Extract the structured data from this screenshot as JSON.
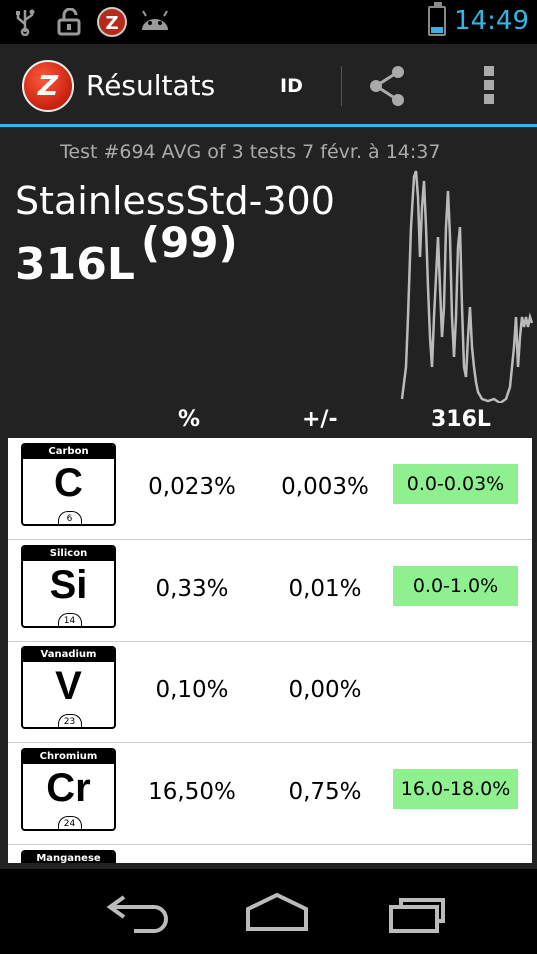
{
  "status_bar": {
    "time": "14:49",
    "icons": [
      "usb-icon",
      "unlock-icon",
      "app-z-icon",
      "android-icon",
      "battery-icon"
    ]
  },
  "action_bar": {
    "logo_letter": "Z",
    "title": "Résultats",
    "id_label": "ID",
    "icons": [
      "share-icon",
      "overflow-menu-icon"
    ]
  },
  "result": {
    "subtitle": "Test #694 AVG of 3 tests 7 févr. à 14:37",
    "alloy_family": "StainlessStd-300",
    "grade": "316L",
    "match_score": "(99)"
  },
  "table": {
    "headers": {
      "percent": "%",
      "error": "+/-",
      "grade": "316L"
    },
    "rows": [
      {
        "element_name": "Carbon",
        "symbol": "C",
        "atomic_number": "6",
        "percent": "0,023%",
        "error": "0,003%",
        "range": "0.0-0.03%"
      },
      {
        "element_name": "Silicon",
        "symbol": "Si",
        "atomic_number": "14",
        "percent": "0,33%",
        "error": "0,01%",
        "range": "0.0-1.0%"
      },
      {
        "element_name": "Vanadium",
        "symbol": "V",
        "atomic_number": "23",
        "percent": "0,10%",
        "error": "0,00%",
        "range": ""
      },
      {
        "element_name": "Chromium",
        "symbol": "Cr",
        "atomic_number": "24",
        "percent": "16,50%",
        "error": "0,75%",
        "range": "16.0-18.0%"
      },
      {
        "element_name": "Manganese",
        "symbol": "",
        "atomic_number": "",
        "percent": "",
        "error": "",
        "range": ""
      }
    ]
  },
  "nav_bar": {
    "icons": [
      "back-icon",
      "home-icon",
      "recent-apps-icon"
    ]
  },
  "colors": {
    "accent": "#33b5e5",
    "range_ok": "#8ff08f",
    "background": "#222222"
  }
}
